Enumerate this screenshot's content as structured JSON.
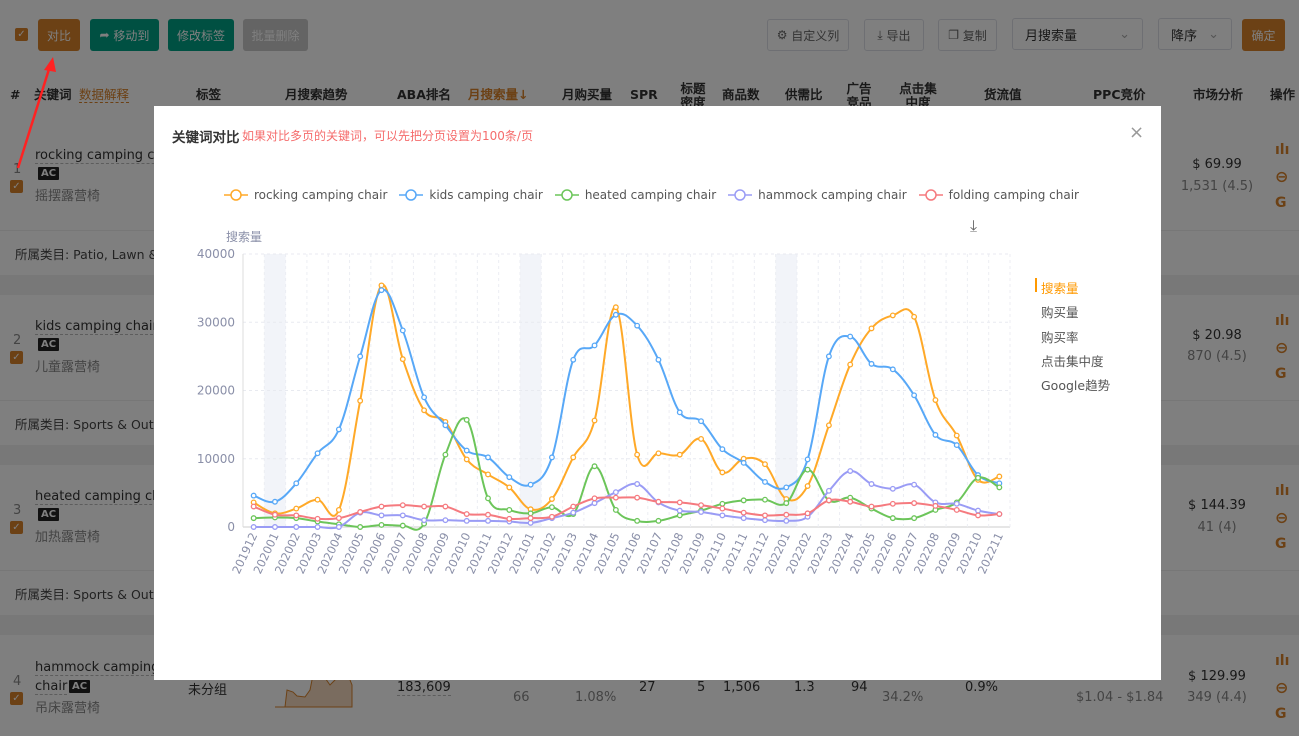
{
  "toolbar": {
    "compare": "对比",
    "move_to": "移动到",
    "edit_tags": "修改标签",
    "batch_delete": "批量删除",
    "custom_columns": "自定义列",
    "export": "导出",
    "copy": "复制",
    "sort_field": "月搜索量",
    "sort_order": "降序",
    "confirm": "确定"
  },
  "table": {
    "headers": [
      "#",
      "关键词",
      "数据解释",
      "标签",
      "月搜索趋势",
      "ABA排名",
      "月搜索量↓",
      "月购买量",
      "SPR",
      "标题密度",
      "商品数",
      "供需比",
      "广告竞品数",
      "点击集中度",
      "货流值",
      "PPC竞价",
      "市场分析",
      "操作"
    ],
    "rows": [
      {
        "index": "1",
        "keyword": "rocking camping chair",
        "badge": "AC",
        "cn": "摇摆露营椅",
        "price": "$ 69.99",
        "reviews": "1,531 (4.5)",
        "category": "所属类目: Patio, Lawn &"
      },
      {
        "index": "2",
        "keyword": "kids camping chair",
        "badge": "AC",
        "cn": "儿童露营椅",
        "price": "$ 20.98",
        "reviews": "870 (4.5)",
        "category": "所属类目: Sports & Outd"
      },
      {
        "index": "3",
        "keyword": "heated camping chair",
        "badge": "AC",
        "cn": "加热露营椅",
        "price": "$ 144.39",
        "reviews": "41 (4)",
        "category": "所属类目: Sports & Outd"
      },
      {
        "index": "4",
        "keyword": "hammock camping",
        "keyword2": "chair",
        "badge": "AC",
        "cn": "吊床露营椅",
        "tag": "未分组",
        "aba": "183,609",
        "buy_sub": "66",
        "spr_sub": "1.08%",
        "spr": "27",
        "title_density": "5",
        "products": "1,506",
        "supply_demand": "1.3",
        "ad_products": "94",
        "click_sub": "34.2%",
        "flow": "0.9%",
        "ppc_range": "$1.04 - $1.84",
        "price": "$ 129.99",
        "reviews": "349 (4.4)"
      }
    ]
  },
  "modal": {
    "title": "关键词对比",
    "hint": "如果对比多页的关键词，可以先把分页设置为100条/页",
    "menu": [
      "搜索量",
      "购买量",
      "购买率",
      "点击集中度",
      "Google趋势"
    ],
    "active_menu": "搜索量"
  },
  "colors": {
    "accent": "#d9822b",
    "teal": "#00a085",
    "active": "#ff9900"
  },
  "chart_data": {
    "type": "line",
    "ylabel": "搜索量",
    "ylim": [
      0,
      40000
    ],
    "yticks": [
      "0",
      "10000",
      "20000",
      "30000",
      "40000"
    ],
    "smooth": true,
    "grid": true,
    "legend": "top",
    "highlight_months": [
      "202001",
      "202101",
      "202201"
    ],
    "categories": [
      "201912",
      "202001",
      "202002",
      "202003",
      "202004",
      "202005",
      "202006",
      "202007",
      "202008",
      "202009",
      "202010",
      "202011",
      "202012",
      "202101",
      "202102",
      "202103",
      "202104",
      "202105",
      "202106",
      "202107",
      "202108",
      "202109",
      "202110",
      "202111",
      "202112",
      "202201",
      "202202",
      "202203",
      "202204",
      "202205",
      "202206",
      "202207",
      "202208",
      "202209",
      "202210",
      "202211"
    ],
    "series": [
      {
        "name": "rocking camping chair",
        "color": "#ffa928",
        "values": [
          3600,
          2000,
          2700,
          4000,
          2500,
          18500,
          35400,
          24600,
          17100,
          15400,
          9900,
          7700,
          5800,
          2600,
          4100,
          10200,
          15600,
          32200,
          10600,
          10800,
          10600,
          12900,
          8000,
          10000,
          9200,
          4100,
          6000,
          14900,
          23800,
          29100,
          31000,
          30800,
          18600,
          13400,
          6900,
          7400
        ]
      },
      {
        "name": "kids camping chair",
        "color": "#58a8f7",
        "values": [
          4600,
          3700,
          6400,
          10800,
          14300,
          25000,
          34700,
          28800,
          19000,
          14900,
          11200,
          10200,
          7300,
          6200,
          10200,
          24500,
          26600,
          31100,
          29500,
          24500,
          16800,
          15500,
          11400,
          9400,
          6600,
          5800,
          9900,
          25000,
          27900,
          23900,
          23100,
          19300,
          13500,
          12000,
          7600,
          6400
        ]
      },
      {
        "name": "heated camping chair",
        "color": "#6cc55a",
        "values": [
          1300,
          1400,
          1300,
          800,
          400,
          0,
          300,
          200,
          500,
          10600,
          15700,
          4200,
          2500,
          2000,
          2900,
          1900,
          8900,
          2500,
          900,
          900,
          1700,
          2400,
          3400,
          3900,
          4000,
          3500,
          8400,
          3900,
          4300,
          2700,
          1300,
          1300,
          2500,
          3600,
          7200,
          5800
        ]
      },
      {
        "name": "hammock camping chair",
        "color": "#9a9cf5",
        "values": [
          0,
          0,
          0,
          0,
          0,
          2100,
          1700,
          1700,
          1000,
          1000,
          900,
          900,
          800,
          600,
          1300,
          2100,
          3500,
          5100,
          6300,
          3600,
          2400,
          2200,
          1700,
          1300,
          1000,
          900,
          1500,
          5300,
          8200,
          6300,
          5600,
          6200,
          3600,
          3400,
          2400,
          1900
        ]
      },
      {
        "name": "folding camping chair",
        "color": "#f57a7f",
        "values": [
          3000,
          1800,
          1700,
          1200,
          1300,
          2200,
          3000,
          3200,
          3000,
          3000,
          1900,
          1800,
          1200,
          1300,
          1500,
          3000,
          4200,
          4300,
          4300,
          3700,
          3600,
          3200,
          2700,
          2100,
          1700,
          1800,
          2000,
          3900,
          3700,
          3000,
          3400,
          3500,
          3100,
          2500,
          1700,
          1900
        ]
      }
    ]
  }
}
